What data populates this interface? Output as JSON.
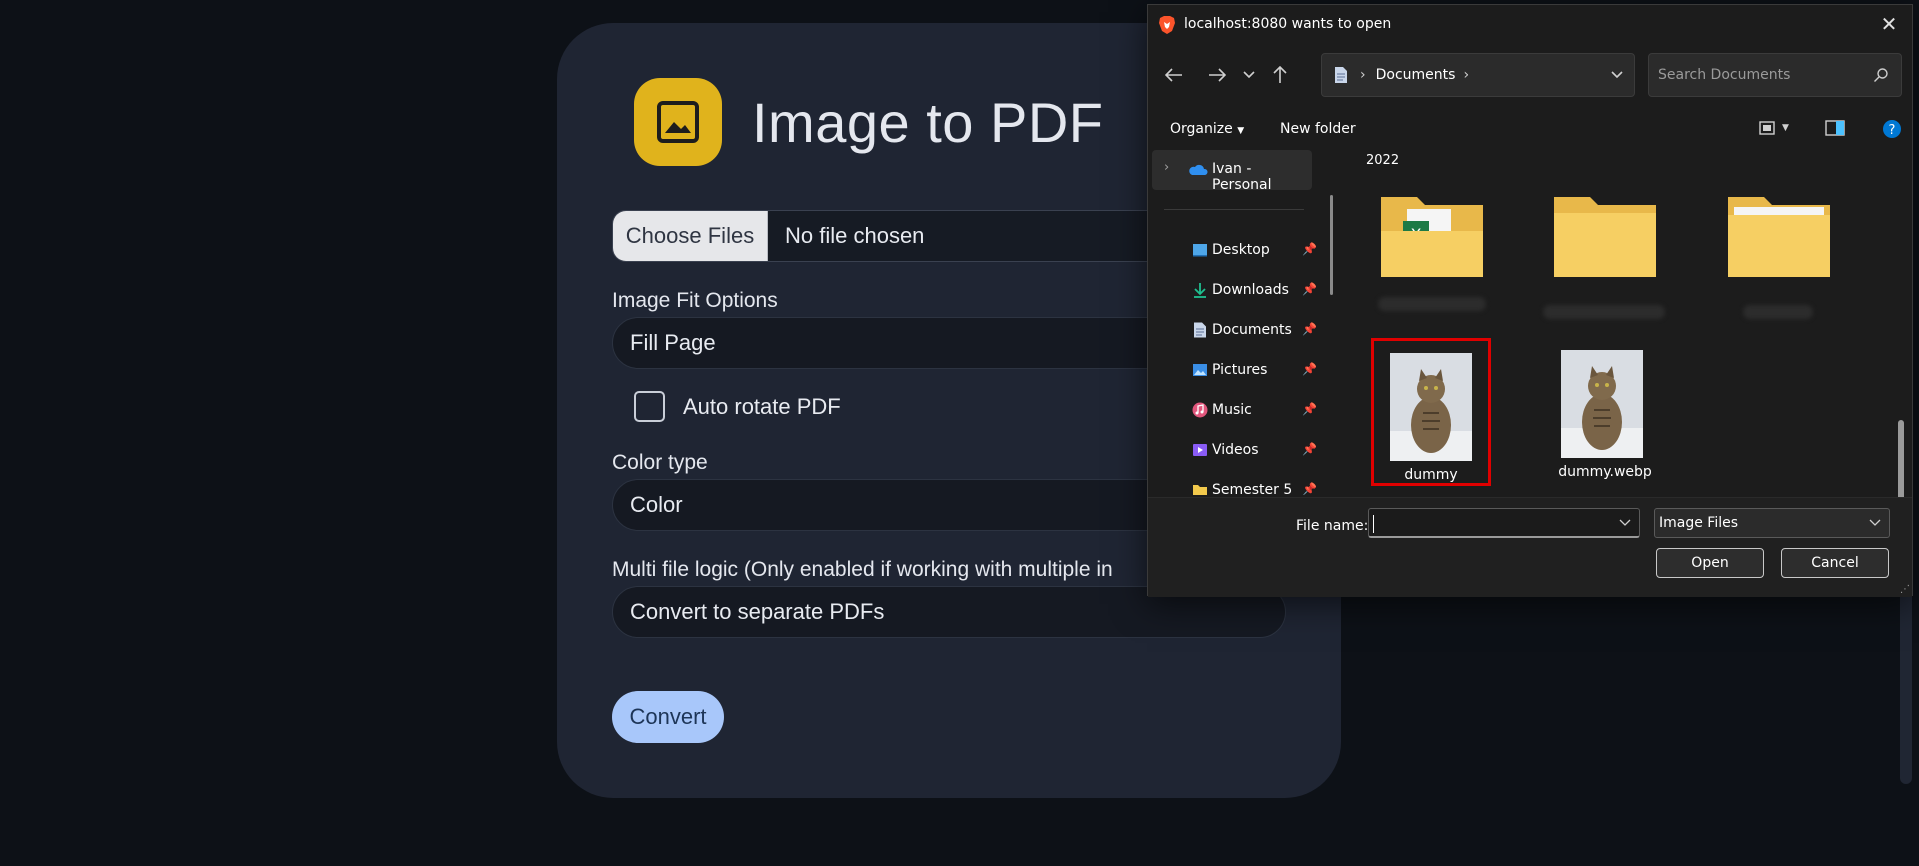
{
  "app": {
    "title": "Image to PDF",
    "logo_icon": "image-icon",
    "accent_color": "#e0b31c",
    "file_input": {
      "button_label": "Choose Files",
      "status": "No file chosen"
    },
    "fit": {
      "label": "Image Fit Options",
      "value": "Fill Page"
    },
    "auto_rotate": {
      "label": "Auto rotate PDF",
      "checked": false
    },
    "color_type": {
      "label": "Color type",
      "value": "Color"
    },
    "multi_file": {
      "label": "Multi file logic (Only enabled if working with multiple in",
      "value": "Convert to separate PDFs"
    },
    "convert_label": "Convert",
    "convert_color": "#a8c7fa"
  },
  "dialog": {
    "title": "localhost:8080 wants to open",
    "address": {
      "location": "Documents"
    },
    "search_placeholder": "Search Documents",
    "commands": {
      "organize": "Organize",
      "new_folder": "New folder"
    },
    "nav": {
      "cloud": "Ivan - Personal",
      "items": [
        {
          "label": "Desktop",
          "icon": "desktop-icon"
        },
        {
          "label": "Downloads",
          "icon": "download-icon"
        },
        {
          "label": "Documents",
          "icon": "document-icon"
        },
        {
          "label": "Pictures",
          "icon": "pictures-icon"
        },
        {
          "label": "Music",
          "icon": "music-icon"
        },
        {
          "label": "Videos",
          "icon": "videos-icon"
        },
        {
          "label": "Semester 5",
          "icon": "folder-icon"
        }
      ]
    },
    "content": {
      "group_label": "2022",
      "files": [
        {
          "name": "dummy",
          "selected": true
        },
        {
          "name": "dummy.webp",
          "selected": false
        }
      ]
    },
    "footer": {
      "file_name_label": "File name:",
      "file_name_value": "",
      "file_type": "Image Files",
      "open_label": "Open",
      "cancel_label": "Cancel"
    }
  }
}
